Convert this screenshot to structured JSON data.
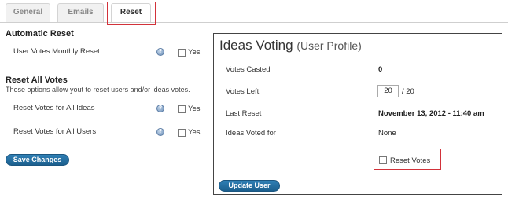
{
  "tabs": [
    {
      "label": "General"
    },
    {
      "label": "Emails"
    },
    {
      "label": "Reset",
      "active": true
    }
  ],
  "automatic_reset": {
    "heading": "Automatic Reset",
    "monthly_label": "User Votes Monthly Reset",
    "yes": "Yes"
  },
  "reset_all": {
    "heading": "Reset All Votes",
    "description": "These options allow yout to reset users and/or ideas votes.",
    "ideas_label": "Reset Votes for All Ideas",
    "users_label": "Reset Votes for All Users",
    "yes": "Yes"
  },
  "save_button": "Save Changes",
  "profile": {
    "title": "Ideas Voting",
    "subtitle": "(User Profile)",
    "rows": [
      {
        "label": "Votes Casted",
        "value": "0"
      },
      {
        "label": "Votes Left",
        "input": "20",
        "suffix": "/ 20"
      },
      {
        "label": "Last Reset",
        "value": "November 13, 2012 - 11:40 am"
      },
      {
        "label": "Ideas Voted for",
        "value": "None"
      }
    ],
    "reset_votes_label": "Reset Votes",
    "update_button": "Update User"
  },
  "colors": {
    "highlight": "#d2323a",
    "button": "#1f6696",
    "help_icon": "#6d8fb8"
  },
  "icons": [
    "help-icon"
  ]
}
